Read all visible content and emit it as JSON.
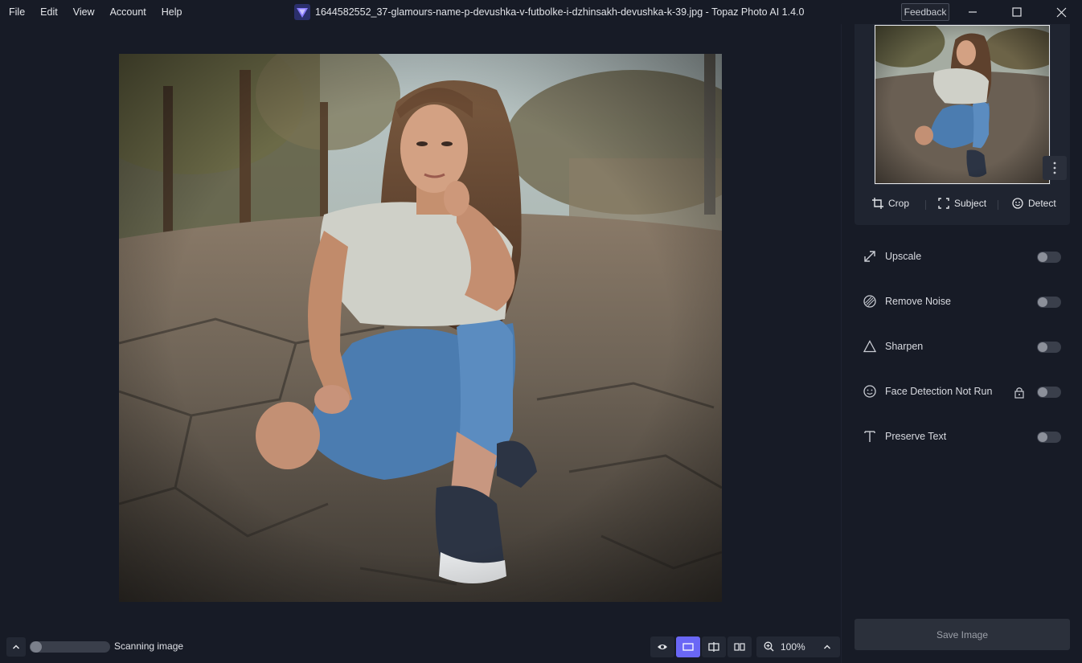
{
  "menu": [
    "File",
    "Edit",
    "View",
    "Account",
    "Help"
  ],
  "window_title": "1644582552_37-glamours-name-p-devushka-v-futbolke-i-dzhinsakh-devushka-k-39.jpg - Topaz Photo AI 1.4.0",
  "feedback_label": "Feedback",
  "window_controls": {
    "minimize": "minimize-icon",
    "maximize": "maximize-icon",
    "close": "close-icon"
  },
  "tools": [
    {
      "label": "Crop",
      "icon": "crop-icon"
    },
    {
      "label": "Subject",
      "icon": "subject-select-icon"
    },
    {
      "label": "Detect",
      "icon": "face-detect-icon"
    }
  ],
  "models": [
    {
      "label": "Upscale",
      "icon": "upscale-icon",
      "enabled": false
    },
    {
      "label": "Remove Noise",
      "icon": "remove-noise-icon",
      "enabled": false
    },
    {
      "label": "Sharpen",
      "icon": "sharpen-icon",
      "enabled": false
    },
    {
      "label": "Face Detection Not Run",
      "icon": "face-icon",
      "enabled": false,
      "locked": true
    },
    {
      "label": "Preserve Text",
      "icon": "text-icon",
      "enabled": false
    }
  ],
  "save_label": "Save Image",
  "status": {
    "text": "Scanning image",
    "progress": 0.08
  },
  "zoom": "100%",
  "view_modes": [
    "preview-eye-icon",
    "single-view-icon",
    "split-view-icon",
    "side-by-side-icon"
  ],
  "colors": {
    "accent": "#6a67f5",
    "background": "#171b26",
    "panel": "#1f2430"
  }
}
